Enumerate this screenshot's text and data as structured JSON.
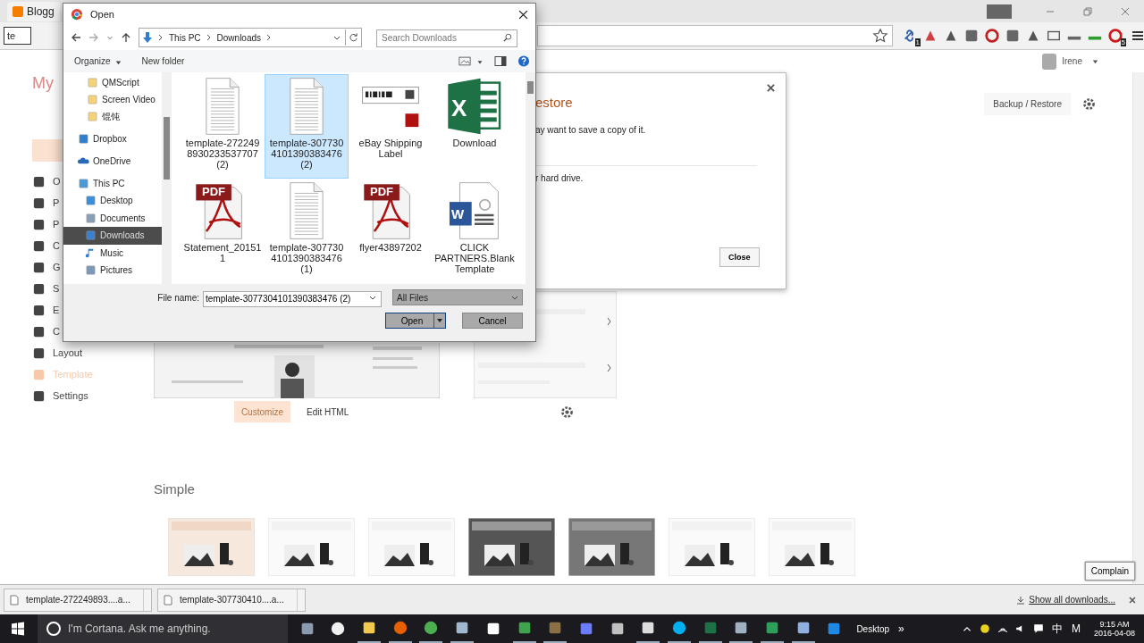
{
  "browser": {
    "tab_title": "Blogg",
    "find_text": "te",
    "user_name": "Irene",
    "extensions": [
      {
        "kind": "link",
        "badge": "1"
      },
      {
        "kind": "pin"
      },
      {
        "kind": "bird"
      },
      {
        "kind": "square"
      },
      {
        "kind": "target"
      },
      {
        "kind": "square"
      },
      {
        "kind": "tool"
      },
      {
        "kind": "cast"
      },
      {
        "kind": "bar"
      },
      {
        "kind": "meter"
      },
      {
        "kind": "opera",
        "badge": "5"
      }
    ]
  },
  "blogger": {
    "blog_title": "My",
    "sidebar": [
      {
        "label": "O",
        "selected": false
      },
      {
        "label": "P",
        "selected": false
      },
      {
        "label": "P",
        "selected": false
      },
      {
        "label": "C",
        "selected": false
      },
      {
        "label": "G",
        "selected": false
      },
      {
        "label": "S",
        "selected": false
      },
      {
        "label": "E",
        "selected": false
      },
      {
        "label": "C",
        "selected": false
      },
      {
        "label": "Layout",
        "selected": false
      },
      {
        "label": "Template",
        "selected": true
      },
      {
        "label": "Settings",
        "selected": false
      }
    ],
    "backup_button": "Backup / Restore",
    "restore_dialog": {
      "title": "estore",
      "line_1": "ay want to save a copy of it.",
      "line_2": "r hard drive.",
      "close_button": "Close"
    },
    "customize_button": "Customize",
    "edit_html_button": "Edit HTML",
    "section_title": "Simple",
    "thumbnails": [
      {
        "kind": "warm"
      },
      {
        "kind": "light"
      },
      {
        "kind": "light"
      },
      {
        "kind": "dark"
      },
      {
        "kind": "gray"
      },
      {
        "kind": "light"
      },
      {
        "kind": "light"
      }
    ],
    "complain_button": "Complain"
  },
  "file_dialog": {
    "title": "Open",
    "path": [
      "This PC",
      "Downloads"
    ],
    "search_placeholder": "Search Downloads",
    "organize_button": "Organize",
    "new_folder_button": "New folder",
    "nav": [
      {
        "kind": "folder",
        "label": "QMScript",
        "selected": false
      },
      {
        "kind": "folder",
        "label": "Screen Video",
        "selected": false
      },
      {
        "kind": "folder",
        "label": "馄饨",
        "selected": false
      },
      {
        "kind": "dropbox",
        "label": "Dropbox",
        "selected": false
      },
      {
        "kind": "onedrive",
        "label": "OneDrive",
        "selected": false
      },
      {
        "kind": "pc",
        "label": "This PC",
        "selected": false,
        "children": [
          {
            "kind": "desktop",
            "label": "Desktop",
            "selected": false
          },
          {
            "kind": "documents",
            "label": "Documents",
            "selected": false
          },
          {
            "kind": "downloads",
            "label": "Downloads",
            "selected": true
          },
          {
            "kind": "music",
            "label": "Music",
            "selected": false
          },
          {
            "kind": "pictures",
            "label": "Pictures",
            "selected": false
          }
        ]
      }
    ],
    "files": [
      {
        "kind": "text",
        "name": "template-2722498930233537707 (2)",
        "selected": false
      },
      {
        "kind": "text",
        "name": "template-3077304101390383476 (2)",
        "selected": true
      },
      {
        "kind": "label",
        "name": "eBay Shipping Label",
        "selected": false
      },
      {
        "kind": "excel",
        "name": "Download",
        "badge": "X",
        "selected": false
      },
      {
        "kind": "pdf",
        "name": "Statement_201511",
        "badge": "PDF",
        "selected": false
      },
      {
        "kind": "text",
        "name": "template-3077304101390383476 (1)",
        "selected": false
      },
      {
        "kind": "pdf",
        "name": "flyer43897202",
        "badge": "PDF",
        "selected": false
      },
      {
        "kind": "word",
        "name": "CLICK PARTNERS.Blank Template",
        "badge": "W",
        "selected": false
      }
    ],
    "file_name_label": "File name:",
    "file_name": "template-3077304101390383476 (2)",
    "file_type": "All Files",
    "open_button": "Open",
    "cancel_button": "Cancel"
  },
  "downloads": {
    "items": [
      "template-272249893....a...",
      "template-307730410....a..."
    ],
    "show_all": "Show all downloads..."
  },
  "taskbar": {
    "search_placeholder": "I'm Cortana. Ask me anything.",
    "apps": [
      {
        "kind": "cube",
        "running": false
      },
      {
        "kind": "clock",
        "running": false
      },
      {
        "kind": "folder",
        "running": true
      },
      {
        "kind": "firefox",
        "running": true
      },
      {
        "kind": "chrome",
        "running": true
      },
      {
        "kind": "window",
        "running": true
      },
      {
        "kind": "store",
        "running": false
      },
      {
        "kind": "game",
        "running": true
      },
      {
        "kind": "paint",
        "running": true
      },
      {
        "kind": "infinity",
        "running": false
      },
      {
        "kind": "tools",
        "running": false
      },
      {
        "kind": "doc",
        "running": true
      },
      {
        "kind": "skype",
        "running": true
      },
      {
        "kind": "excel",
        "running": true
      },
      {
        "kind": "notepad",
        "running": true
      },
      {
        "kind": "greenapp",
        "running": true
      },
      {
        "kind": "viewer",
        "running": true
      },
      {
        "kind": "edge",
        "running": false
      }
    ],
    "desktop_label": "Desktop",
    "more": "»",
    "ime": "中",
    "ime_mode": "M",
    "time": "9:15 AM",
    "date": "2016-04-08"
  }
}
